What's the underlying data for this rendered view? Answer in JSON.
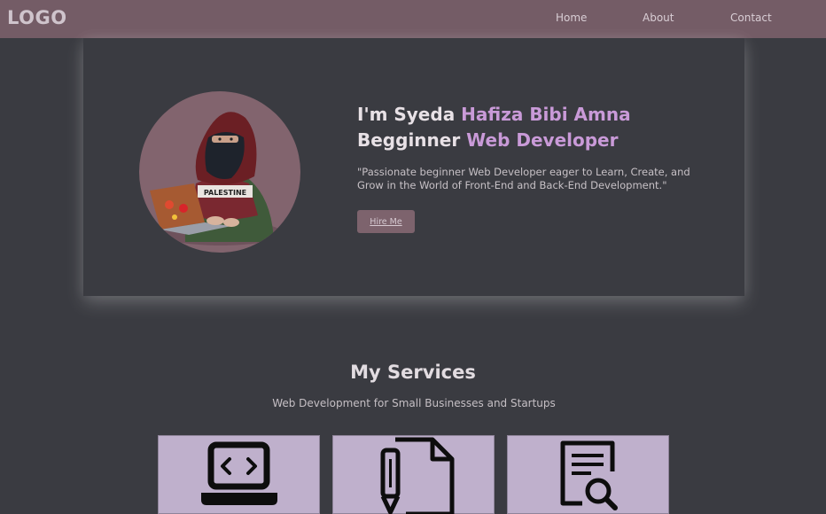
{
  "navbar": {
    "logo": "LOGO",
    "links": [
      {
        "label": "Home"
      },
      {
        "label": "About"
      },
      {
        "label": "Contact"
      }
    ]
  },
  "hero": {
    "title_line1_plain": "I'm Syeda ",
    "title_line1_accent": "Hafiza Bibi Amna",
    "title_line2_plain": "Begginner ",
    "title_line2_accent": "Web Developer",
    "description": "\"Passionate beginner Web Developer eager to Learn, Create, and Grow in the World of Front-End and Back-End Development.\"",
    "hire_button": "Hire Me",
    "avatar_caption": "PALESTINE"
  },
  "services": {
    "title": "My Services",
    "subtitle": "Web Development for Small Businesses and Startups",
    "cards": [
      {
        "icon": "laptop-code-icon"
      },
      {
        "icon": "document-pen-icon"
      },
      {
        "icon": "document-search-icon"
      }
    ]
  },
  "colors": {
    "navbar": "#745c66",
    "background": "#3a3b41",
    "accent": "#c99ad8",
    "card": "#bfb0cc"
  }
}
